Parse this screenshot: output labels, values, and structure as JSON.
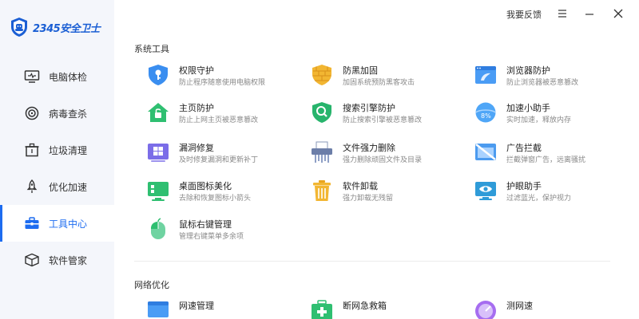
{
  "app": {
    "logo_text": "2345安全卫士"
  },
  "header": {
    "feedback_label": "我要反馈"
  },
  "sidebar": {
    "items": [
      {
        "label": "电脑体检",
        "icon": "monitor-icon"
      },
      {
        "label": "病毒查杀",
        "icon": "target-icon"
      },
      {
        "label": "垃圾清理",
        "icon": "trash-bin-icon"
      },
      {
        "label": "优化加速",
        "icon": "rocket-icon"
      },
      {
        "label": "工具中心",
        "icon": "toolbox-icon",
        "active": true
      },
      {
        "label": "软件管家",
        "icon": "package-box-icon"
      }
    ]
  },
  "sections": {
    "system_tools": {
      "title": "系统工具"
    },
    "network": {
      "title": "网络优化"
    }
  },
  "tools": [
    {
      "name": "权限守护",
      "desc": "防止程序随意使用电脑权限",
      "icon": "shield-key-icon"
    },
    {
      "name": "防黑加固",
      "desc": "加固系统预防黑客攻击",
      "icon": "brick-shield-icon"
    },
    {
      "name": "浏览器防护",
      "desc": "防止浏览器被恶意篡改",
      "icon": "browser-icon"
    },
    {
      "name": "主页防护",
      "desc": "防止上网主页被恶意篡改",
      "icon": "house-lock-icon"
    },
    {
      "name": "搜索引擎防护",
      "desc": "防止搜索引擎被恶意篡改",
      "icon": "search-shield-icon"
    },
    {
      "name": "加速小助手",
      "desc": "实时加速，释放内存",
      "icon": "memory-boost-icon"
    },
    {
      "name": "漏洞修复",
      "desc": "及时修复漏洞和更新补丁",
      "icon": "windows-patch-icon"
    },
    {
      "name": "文件强力删除",
      "desc": "强力删除顽固文件及目录",
      "icon": "shredder-icon"
    },
    {
      "name": "广告拦截",
      "desc": "拦截弹窗广告，远离骚扰",
      "icon": "ad-block-icon"
    },
    {
      "name": "桌面图标美化",
      "desc": "去除和恢复图标小箭头",
      "icon": "desktop-icon"
    },
    {
      "name": "软件卸载",
      "desc": "强力卸载无残留",
      "icon": "uninstall-bin-icon"
    },
    {
      "name": "护眼助手",
      "desc": "过滤蓝光，保护视力",
      "icon": "eye-care-monitor-icon"
    },
    {
      "name": "鼠标右键管理",
      "desc": "管理右键菜单多余项",
      "icon": "mouse-icon"
    },
    {
      "name": "网速管理",
      "desc": "",
      "icon": "net-speed-icon"
    },
    {
      "name": "断网急救箱",
      "desc": "",
      "icon": "first-aid-kit-icon"
    },
    {
      "name": "测网速",
      "desc": "",
      "icon": "speed-test-icon"
    }
  ],
  "colors": {
    "accent": "#1d6cf0",
    "sidebar_bg": "#f4f6fb",
    "active_bg": "#ffffff"
  }
}
